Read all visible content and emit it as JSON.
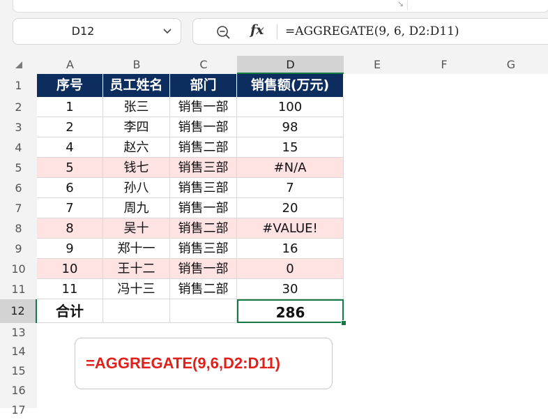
{
  "name_box": {
    "value": "D12"
  },
  "formula_bar": {
    "formula": "=AGGREGATE(9, 6, D2:D11)"
  },
  "column_headers": [
    "A",
    "B",
    "C",
    "D",
    "E",
    "F",
    "G"
  ],
  "row_headers": [
    "1",
    "2",
    "3",
    "4",
    "5",
    "6",
    "7",
    "8",
    "9",
    "10",
    "11",
    "12",
    "13",
    "14",
    "15",
    "16",
    "17"
  ],
  "table": {
    "headers": [
      "序号",
      "员工姓名",
      "部门",
      "销售额(万元)"
    ],
    "rows": [
      [
        "1",
        "张三",
        "销售一部",
        "100"
      ],
      [
        "2",
        "李四",
        "销售一部",
        "98"
      ],
      [
        "4",
        "赵六",
        "销售二部",
        "15"
      ],
      [
        "5",
        "钱七",
        "销售三部",
        "#N/A"
      ],
      [
        "6",
        "孙八",
        "销售三部",
        "7"
      ],
      [
        "7",
        "周九",
        "销售一部",
        "20"
      ],
      [
        "8",
        "吴十",
        "销售二部",
        "#VALUE!"
      ],
      [
        "9",
        "郑十一",
        "销售三部",
        "16"
      ],
      [
        "10",
        "王十二",
        "销售一部",
        "0"
      ],
      [
        "11",
        "冯十三",
        "销售二部",
        "30"
      ]
    ],
    "highlighted_rows": [
      3,
      6,
      8
    ],
    "total_label": "合计",
    "total_value": "286"
  },
  "annotation": {
    "text": "=AGGREGATE(9,6,D2:D11)"
  },
  "colors": {
    "header_fill": "#0c2d5e",
    "highlight_fill": "#ffe3e3",
    "selection": "#137a43",
    "annotation_text": "#e0201b"
  },
  "icons": [
    "resize-icon",
    "chevron-down-icon",
    "zoom-icon",
    "fx-icon",
    "select-all-icon"
  ]
}
